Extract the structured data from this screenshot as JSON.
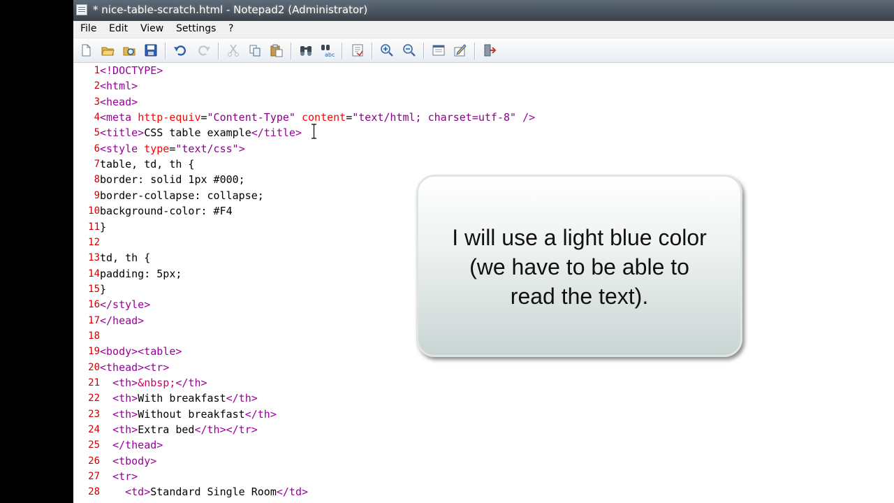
{
  "window": {
    "title": "* nice-table-scratch.html - Notepad2 (Administrator)"
  },
  "menu": [
    "File",
    "Edit",
    "View",
    "Settings",
    "?"
  ],
  "toolbar_icons": [
    "new-file-icon",
    "open-file-icon",
    "browse-icon",
    "save-icon",
    "undo-icon",
    "redo-icon",
    "cut-icon",
    "copy-icon",
    "paste-icon",
    "find-icon",
    "replace-icon",
    "goto-icon",
    "zoom-in-icon",
    "zoom-out-icon",
    "view-icon",
    "settings-icon",
    "exit-icon"
  ],
  "callout": {
    "line1": "I will use a light blue color",
    "line2": "(we have to be able to",
    "line3": "read the text)."
  },
  "editor": {
    "lines": [
      {
        "n": "1",
        "segs": [
          [
            "t",
            "<!DOCTYPE>"
          ]
        ]
      },
      {
        "n": "2",
        "segs": [
          [
            "t",
            "<html>"
          ]
        ]
      },
      {
        "n": "3",
        "segs": [
          [
            "t",
            "<head>"
          ]
        ]
      },
      {
        "n": "4",
        "segs": [
          [
            "t",
            "<meta "
          ],
          [
            "a",
            "http-equiv"
          ],
          [
            "p",
            "="
          ],
          [
            "v",
            "\"Content-Type\" "
          ],
          [
            "a",
            "content"
          ],
          [
            "p",
            "="
          ],
          [
            "v",
            "\"text/html; charset=utf-8\" "
          ],
          [
            "t",
            "/>"
          ]
        ]
      },
      {
        "n": "5",
        "segs": [
          [
            "t",
            "<title>"
          ],
          [
            "p",
            "CSS table example"
          ],
          [
            "t",
            "</title>"
          ]
        ]
      },
      {
        "n": "6",
        "segs": [
          [
            "t",
            "<style "
          ],
          [
            "a",
            "type"
          ],
          [
            "p",
            "="
          ],
          [
            "v",
            "\"text/css\""
          ],
          [
            "t",
            ">"
          ]
        ]
      },
      {
        "n": "7",
        "segs": [
          [
            "p",
            "table, td, th {"
          ]
        ]
      },
      {
        "n": "8",
        "segs": [
          [
            "p",
            "border: solid 1px #000;"
          ]
        ]
      },
      {
        "n": "9",
        "segs": [
          [
            "p",
            "border-collapse: collapse;"
          ]
        ]
      },
      {
        "n": "10",
        "segs": [
          [
            "p",
            "background-color: #F4"
          ]
        ]
      },
      {
        "n": "11",
        "segs": [
          [
            "p",
            "}"
          ]
        ]
      },
      {
        "n": "12",
        "segs": []
      },
      {
        "n": "13",
        "segs": [
          [
            "p",
            "td, th {"
          ]
        ]
      },
      {
        "n": "14",
        "segs": [
          [
            "p",
            "padding: 5px;"
          ]
        ]
      },
      {
        "n": "15",
        "segs": [
          [
            "p",
            "}"
          ]
        ]
      },
      {
        "n": "16",
        "segs": [
          [
            "t",
            "</style>"
          ]
        ]
      },
      {
        "n": "17",
        "segs": [
          [
            "t",
            "</head>"
          ]
        ]
      },
      {
        "n": "18",
        "segs": []
      },
      {
        "n": "19",
        "segs": [
          [
            "t",
            "<body><table>"
          ]
        ]
      },
      {
        "n": "20",
        "segs": [
          [
            "t",
            "<thead><tr>"
          ]
        ]
      },
      {
        "n": "21",
        "segs": [
          [
            "p",
            "  "
          ],
          [
            "t",
            "<th>"
          ],
          [
            "e",
            "&nbsp;"
          ],
          [
            "t",
            "</th>"
          ]
        ]
      },
      {
        "n": "22",
        "segs": [
          [
            "p",
            "  "
          ],
          [
            "t",
            "<th>"
          ],
          [
            "p",
            "With breakfast"
          ],
          [
            "t",
            "</th>"
          ]
        ]
      },
      {
        "n": "23",
        "segs": [
          [
            "p",
            "  "
          ],
          [
            "t",
            "<th>"
          ],
          [
            "p",
            "Without breakfast"
          ],
          [
            "t",
            "</th>"
          ]
        ]
      },
      {
        "n": "24",
        "segs": [
          [
            "p",
            "  "
          ],
          [
            "t",
            "<th>"
          ],
          [
            "p",
            "Extra bed"
          ],
          [
            "t",
            "</th></tr>"
          ]
        ]
      },
      {
        "n": "25",
        "segs": [
          [
            "p",
            "  "
          ],
          [
            "t",
            "</thead>"
          ]
        ]
      },
      {
        "n": "26",
        "segs": [
          [
            "p",
            "  "
          ],
          [
            "t",
            "<tbody>"
          ]
        ]
      },
      {
        "n": "27",
        "segs": [
          [
            "p",
            "  "
          ],
          [
            "t",
            "<tr>"
          ]
        ]
      },
      {
        "n": "28",
        "segs": [
          [
            "p",
            "    "
          ],
          [
            "t",
            "<td>"
          ],
          [
            "p",
            "Standard Single Room"
          ],
          [
            "t",
            "</td>"
          ]
        ]
      }
    ]
  }
}
